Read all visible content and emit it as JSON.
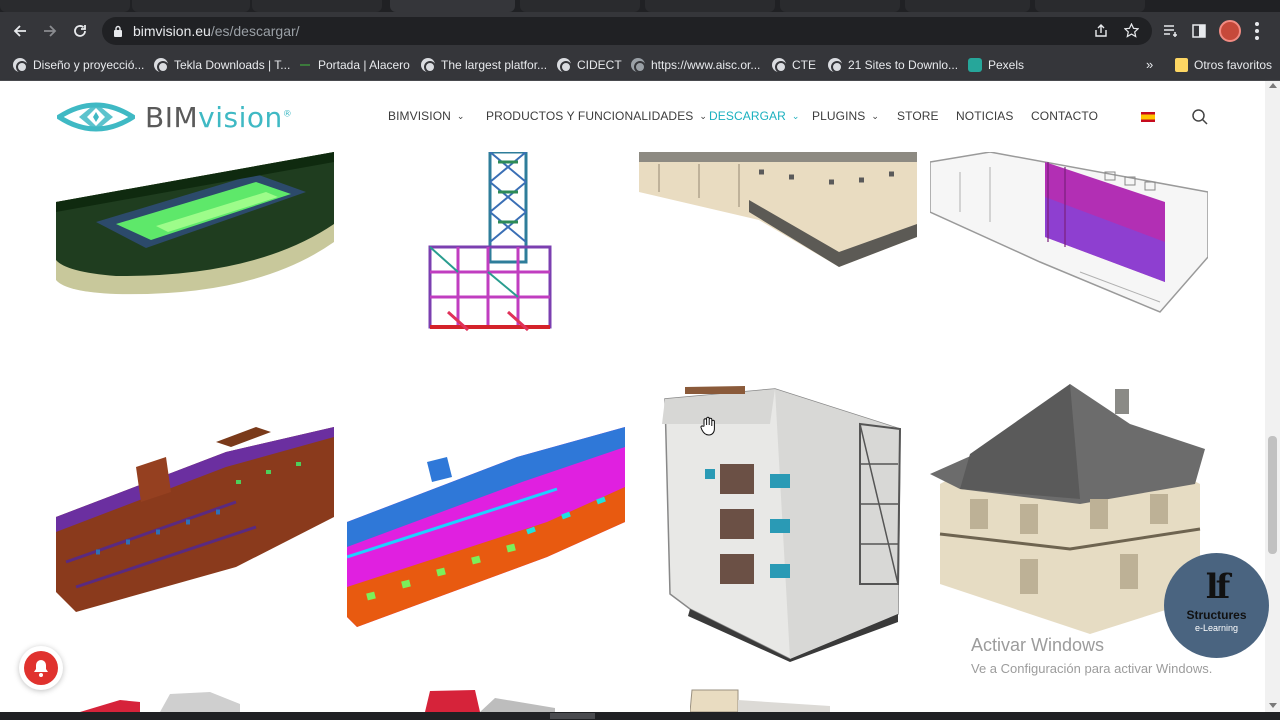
{
  "browser": {
    "url_host": "bimvision.eu",
    "url_path": "/es/descargar/",
    "bookmarks": [
      "Diseño y proyecció...",
      "Tekla Downloads | T...",
      "Portada | Alacero",
      "The largest platfor...",
      "CIDECT",
      "https://www.aisc.or...",
      "CTE",
      "21 Sites to Downlo...",
      "Pexels"
    ],
    "more_bookmarks": "»",
    "other_bookmarks": "Otros favoritos"
  },
  "site": {
    "logo_prefix": "BIM",
    "logo_suffix": "vision",
    "logo_mark": "®",
    "menu": [
      {
        "label": "BIMVISION",
        "dropdown": true,
        "active": false
      },
      {
        "label": "PRODUCTOS Y FUNCIONALIDADES",
        "dropdown": true,
        "active": false
      },
      {
        "label": "DESCARGAR",
        "dropdown": true,
        "active": true
      },
      {
        "label": "PLUGINS",
        "dropdown": true,
        "active": false
      },
      {
        "label": "STORE",
        "dropdown": false,
        "active": false
      },
      {
        "label": "NOTICIAS",
        "dropdown": false,
        "active": false
      },
      {
        "label": "CONTACTO",
        "dropdown": false,
        "active": false
      }
    ],
    "chevron": "⌄",
    "language": "es"
  },
  "overlays": {
    "badge_mark": "lf",
    "badge_title": "Structures",
    "badge_subtitle": "e-Learning",
    "watermark_title": "Activar Windows",
    "watermark_text": "Ve a Configuración para activar Windows."
  },
  "colors": {
    "accent": "#1bb0bf",
    "chrome_dark": "#35363a",
    "notification_red": "#e0322e",
    "badge_blue": "#4a6480"
  }
}
